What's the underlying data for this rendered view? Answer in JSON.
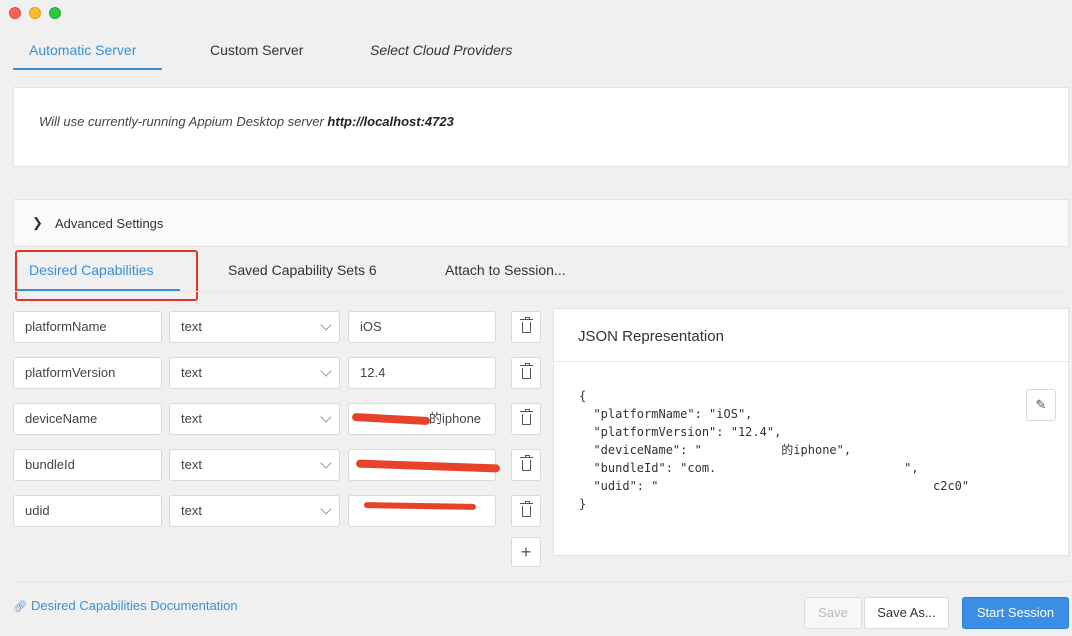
{
  "server_tabs": {
    "automatic": "Automatic Server",
    "custom": "Custom Server",
    "cloud": "Select Cloud Providers"
  },
  "server_message": {
    "prefix": "Will use currently-running Appium Desktop server",
    "url": "http://localhost:4723"
  },
  "advanced_settings": {
    "label": "Advanced Settings"
  },
  "cap_tabs": {
    "desired": "Desired Capabilities",
    "saved": "Saved Capability Sets 6",
    "attach": "Attach to Session..."
  },
  "capabilities": [
    {
      "name": "platformName",
      "type": "text",
      "value": "iOS"
    },
    {
      "name": "platformVersion",
      "type": "text",
      "value": "12.4"
    },
    {
      "name": "deviceName",
      "type": "text",
      "value": "的iphone"
    },
    {
      "name": "bundleId",
      "type": "text",
      "value": ""
    },
    {
      "name": "udid",
      "type": "text",
      "value": ""
    }
  ],
  "json_panel": {
    "title": "JSON Representation",
    "content": "{\n  \"platformName\": \"iOS\",\n  \"platformVersion\": \"12.4\",\n  \"deviceName\": \"           的iphone\",\n  \"bundleId\": \"com.                          \",\n  \"udid\": \"                                      c2c0\"\n}"
  },
  "footer": {
    "doc_link": "Desired Capabilities Documentation",
    "save": "Save",
    "save_as": "Save As...",
    "start": "Start Session"
  },
  "colors": {
    "accent": "#3b8fd9",
    "highlight": "#e0352b",
    "redaction": "#e6432a",
    "primary_button": "#3a8ee6"
  }
}
